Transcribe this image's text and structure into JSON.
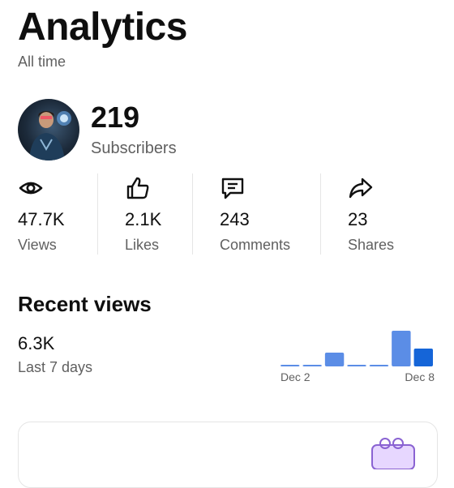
{
  "header": {
    "title": "Analytics",
    "subtitle": "All time"
  },
  "channel": {
    "subscribers_value": "219",
    "subscribers_label": "Subscribers",
    "avatar_icon": "avatar"
  },
  "stats": [
    {
      "icon": "eye-icon",
      "value": "47.7K",
      "label": "Views"
    },
    {
      "icon": "thumb-up-icon",
      "value": "2.1K",
      "label": "Likes"
    },
    {
      "icon": "comment-icon",
      "value": "243",
      "label": "Comments"
    },
    {
      "icon": "share-icon",
      "value": "23",
      "label": "Shares"
    }
  ],
  "recent_views": {
    "title": "Recent views",
    "value": "6.3K",
    "label": "Last 7 days"
  },
  "chart_data": {
    "type": "bar",
    "categories": [
      "Dec 2",
      "Dec 3",
      "Dec 4",
      "Dec 5",
      "Dec 6",
      "Dec 7",
      "Dec 8"
    ],
    "values": [
      2,
      2,
      17,
      2,
      2,
      44,
      22
    ],
    "x_tick_labels": [
      "Dec 2",
      "Dec 8"
    ],
    "ylim": [
      0,
      46
    ],
    "colors": {
      "bar": "#5b8de6",
      "bar_last": "#1565d8"
    }
  },
  "colors": {
    "accent": "#1565d8",
    "muted_text": "#606060"
  }
}
